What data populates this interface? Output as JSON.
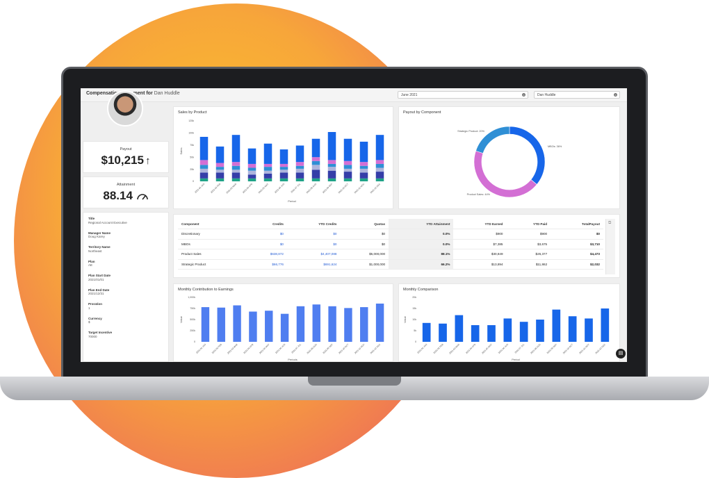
{
  "header": {
    "title_prefix": "Compensation Statement for",
    "employee_name": "Dan Huddle",
    "period_select": "June 2021",
    "employee_select": "Dan Huddle"
  },
  "kpis": {
    "payout_label": "Payout",
    "payout_value": "$10,215",
    "payout_icon": "arrow-up-icon",
    "attainment_label": "Attainment",
    "attainment_value": "88.14",
    "attainment_icon": "gauge-icon"
  },
  "profile": [
    {
      "label": "Title",
      "value": "Regional Account Executive"
    },
    {
      "label": "Manager Name",
      "value": "Doug Karey"
    },
    {
      "label": "Territory Name",
      "value": "Northeast"
    },
    {
      "label": "Plan",
      "value": "AE"
    },
    {
      "label": "Plan Start Date",
      "value": "2021/01/01"
    },
    {
      "label": "Plan End Date",
      "value": "2021/12/31"
    },
    {
      "label": "Proration",
      "value": "1"
    },
    {
      "label": "Currency",
      "value": "$"
    },
    {
      "label": "Target Incentive",
      "value": "70000"
    }
  ],
  "table": {
    "columns": [
      "Component",
      "Credits",
      "YTD Credits",
      "Quotas",
      "YTD Attainment",
      "YTD Earned",
      "YTD Paid",
      "TotalPayout"
    ],
    "rows": [
      [
        "Discretionary",
        "$0",
        "$0",
        "$0",
        "0.0%",
        "$900",
        "$900",
        "$0"
      ],
      [
        "MBOs",
        "$0",
        "$0",
        "$0",
        "0.0%",
        "$7,385",
        "$3,675",
        "$3,710"
      ],
      [
        "Product Sales",
        "$638,872",
        "$4,407,088",
        "$5,000,000",
        "88.1%",
        "$30,849",
        "$26,377",
        "$4,473"
      ],
      [
        "Strategic Product",
        "$66,776",
        "$691,624",
        "$1,000,000",
        "66.2%",
        "$13,894",
        "$11,862",
        "$2,032"
      ]
    ]
  },
  "charts": {
    "sales_title": "Sales by Product",
    "payout_title": "Payout by Component",
    "contrib_title": "Monthly Contribution to Earnings",
    "compare_title": "Monthly Comparison"
  },
  "chart_data": [
    {
      "type": "bar",
      "title": "Sales by Product",
      "xlabel": "Period",
      "ylabel": "Sales",
      "ylim": [
        0,
        125000
      ],
      "yticks": [
        "125k",
        "100k",
        "75k",
        "50k",
        "25k",
        "0"
      ],
      "categories": [
        "2021-01 JAN",
        "2021-02 FEB",
        "2021-03 MAR",
        "2021-04 APR",
        "2021-05 MAY",
        "2021-06 JUN",
        "2021-07 JUL",
        "2021-08 AUG",
        "2021-09 SEP",
        "2021-10 OCT",
        "2021-11 NOV",
        "2021-12 DEC"
      ],
      "stacked": true,
      "series": [
        {
          "values": [
            6000,
            6000,
            6000,
            6000,
            6000,
            6000,
            6000,
            6000,
            6000,
            6000,
            6000,
            6000
          ],
          "color": "#1fa287"
        },
        {
          "values": [
            12000,
            12000,
            12000,
            8000,
            10000,
            12000,
            12000,
            18000,
            16000,
            14000,
            12000,
            14000
          ],
          "color": "#353ea8"
        },
        {
          "values": [
            8000,
            6000,
            6000,
            8000,
            6000,
            6000,
            8000,
            10000,
            8000,
            6000,
            8000,
            8000
          ],
          "color": "#aeb5dd"
        },
        {
          "values": [
            8000,
            6000,
            8000,
            6000,
            8000,
            6000,
            6000,
            8000,
            6000,
            8000,
            6000,
            8000
          ],
          "color": "#2f8fd5"
        },
        {
          "values": [
            10000,
            8000,
            8000,
            8000,
            6000,
            6000,
            8000,
            8000,
            8000,
            8000,
            8000,
            8000
          ],
          "color": "#d36fd4"
        },
        {
          "values": [
            48000,
            34000,
            56000,
            32000,
            42000,
            30000,
            34000,
            38000,
            58000,
            46000,
            42000,
            52000
          ],
          "color": "#1766e9"
        }
      ]
    },
    {
      "type": "pie",
      "title": "Payout by Component",
      "donut": true,
      "slices": [
        {
          "label": "MBOs: 36%",
          "value": 36,
          "color": "#1766e9"
        },
        {
          "label": "Product Sales: 44%",
          "value": 44,
          "color": "#d36fd4"
        },
        {
          "label": "Strategic Product: 20%",
          "value": 20,
          "color": "#2f8fd5"
        }
      ]
    },
    {
      "type": "bar",
      "title": "Monthly Contribution to Earnings",
      "xlabel": "Periods",
      "ylabel": "Value",
      "ylim": [
        0,
        1000000
      ],
      "yticks": [
        "1,000k",
        "750k",
        "500k",
        "250k",
        "0"
      ],
      "categories": [
        "2021-01 JAN",
        "2021-02 FEB",
        "2021-03 MAR",
        "2021-04 APR",
        "2021-05 MAY",
        "2021-06 JUN",
        "2021-07 JUL",
        "2021-08 AUG",
        "2021-09 SEP",
        "2021-10 OCT",
        "2021-11 NOV",
        "2021-12 DEC"
      ],
      "values": [
        780000,
        770000,
        820000,
        680000,
        700000,
        630000,
        800000,
        840000,
        800000,
        760000,
        780000,
        860000
      ],
      "color": "#4f7ef0"
    },
    {
      "type": "bar",
      "title": "Monthly Comparison",
      "xlabel": "Period",
      "ylabel": "Value",
      "ylim": [
        0,
        20000
      ],
      "yticks": [
        "20k",
        "15k",
        "10k",
        "5k",
        "0"
      ],
      "categories": [
        "2021-01 JAN",
        "2021-02 FEB",
        "2021-03 MAR",
        "2021-04 APR",
        "2021-05 MAY",
        "2021-06 JUN",
        "2021-07 JUL",
        "2021-08 AUG",
        "2021-09 SEP",
        "2021-10 OCT",
        "2021-11 NOV",
        "2021-12 DEC"
      ],
      "values": [
        8500,
        8200,
        12000,
        7500,
        7500,
        10500,
        9000,
        10000,
        14500,
        11500,
        10500,
        15000
      ],
      "color": "#1766e9"
    }
  ]
}
